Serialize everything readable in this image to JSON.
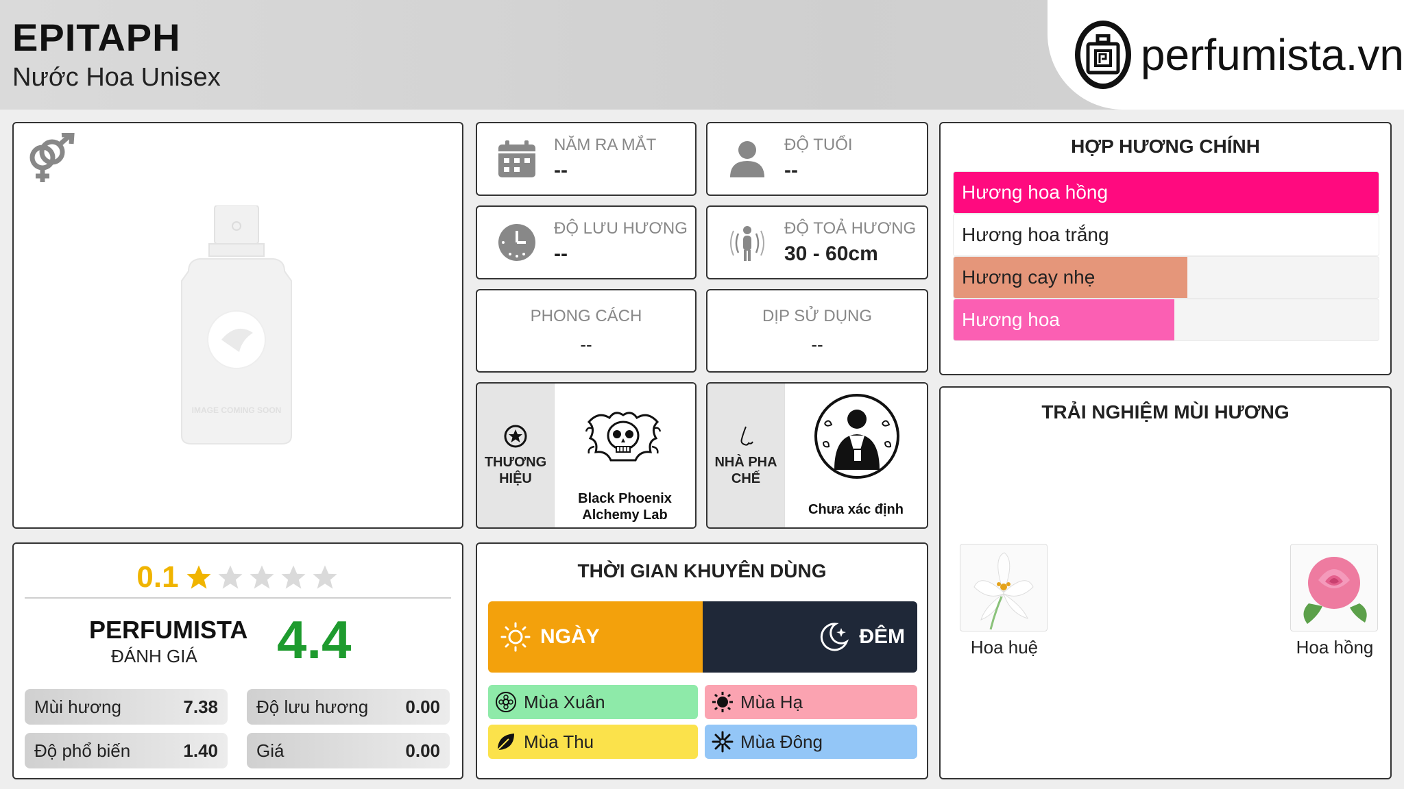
{
  "header": {
    "title": "EPITAPH",
    "subtitle": "Nước Hoa Unisex",
    "logo_text": "perfumista.vn"
  },
  "image_card": {
    "placeholder_text": "IMAGE COMING SOON",
    "gender_icon": "unisex-gender-icon"
  },
  "rating": {
    "user_rating": "0.1",
    "stars_total": 5,
    "stars_filled_fraction": 0.02,
    "perfumista_name": "PERFUMISTA",
    "perfumista_sub": "ĐÁNH GIÁ",
    "perfumista_score": "4.4",
    "stats": [
      {
        "label": "Mùi hương",
        "value": "7.38"
      },
      {
        "label": "Độ lưu hương",
        "value": "0.00"
      },
      {
        "label": "Độ phổ biến",
        "value": "1.40"
      },
      {
        "label": "Giá",
        "value": "0.00"
      }
    ]
  },
  "info": {
    "release_year": {
      "label": "NĂM RA MẮT",
      "value": "--"
    },
    "age": {
      "label": "ĐỘ TUỔI",
      "value": "--"
    },
    "longevity": {
      "label": "ĐỘ LƯU HƯƠNG",
      "value": "--"
    },
    "sillage": {
      "label": "ĐỘ TOẢ HƯƠNG",
      "value": "30 - 60cm"
    },
    "style": {
      "label": "PHONG CÁCH",
      "value": "--"
    },
    "occasion": {
      "label": "DỊP SỬ DỤNG",
      "value": "--"
    },
    "brand": {
      "label": "THƯƠNG HIỆU",
      "value": "Black Phoenix Alchemy Lab"
    },
    "perfumer": {
      "label": "NHÀ PHA CHẾ",
      "value": "Chưa xác định"
    }
  },
  "time": {
    "title": "THỜI GIAN KHUYÊN DÙNG",
    "day": "NGÀY",
    "night": "ĐÊM",
    "seasons": {
      "spring": {
        "label": "Mùa Xuân",
        "color": "#8eeaa9"
      },
      "summer": {
        "label": "Mùa Hạ",
        "color": "#fba3b1"
      },
      "autumn": {
        "label": "Mùa Thu",
        "color": "#fbe24b"
      },
      "winter": {
        "label": "Mùa Đông",
        "color": "#93c6f7"
      }
    }
  },
  "accords": {
    "title": "HỢP HƯƠNG CHÍNH",
    "items": [
      {
        "label": "Hương hoa hồng",
        "percent": 100,
        "color": "#ff0a7f"
      },
      {
        "label": "Hương hoa trắng",
        "percent": 100,
        "color": "#ffffff"
      },
      {
        "label": "Hương cay nhẹ",
        "percent": 55,
        "color": "#e5967a"
      },
      {
        "label": "Hương hoa",
        "percent": 52,
        "color": "#fb5fb3"
      }
    ]
  },
  "experience": {
    "title": "TRẢI NGHIỆM MÙI HƯƠNG",
    "notes": [
      {
        "label": "Hoa huệ",
        "icon": "lily-flower-icon"
      },
      {
        "label": "Hoa hồng",
        "icon": "rose-flower-icon"
      }
    ]
  }
}
